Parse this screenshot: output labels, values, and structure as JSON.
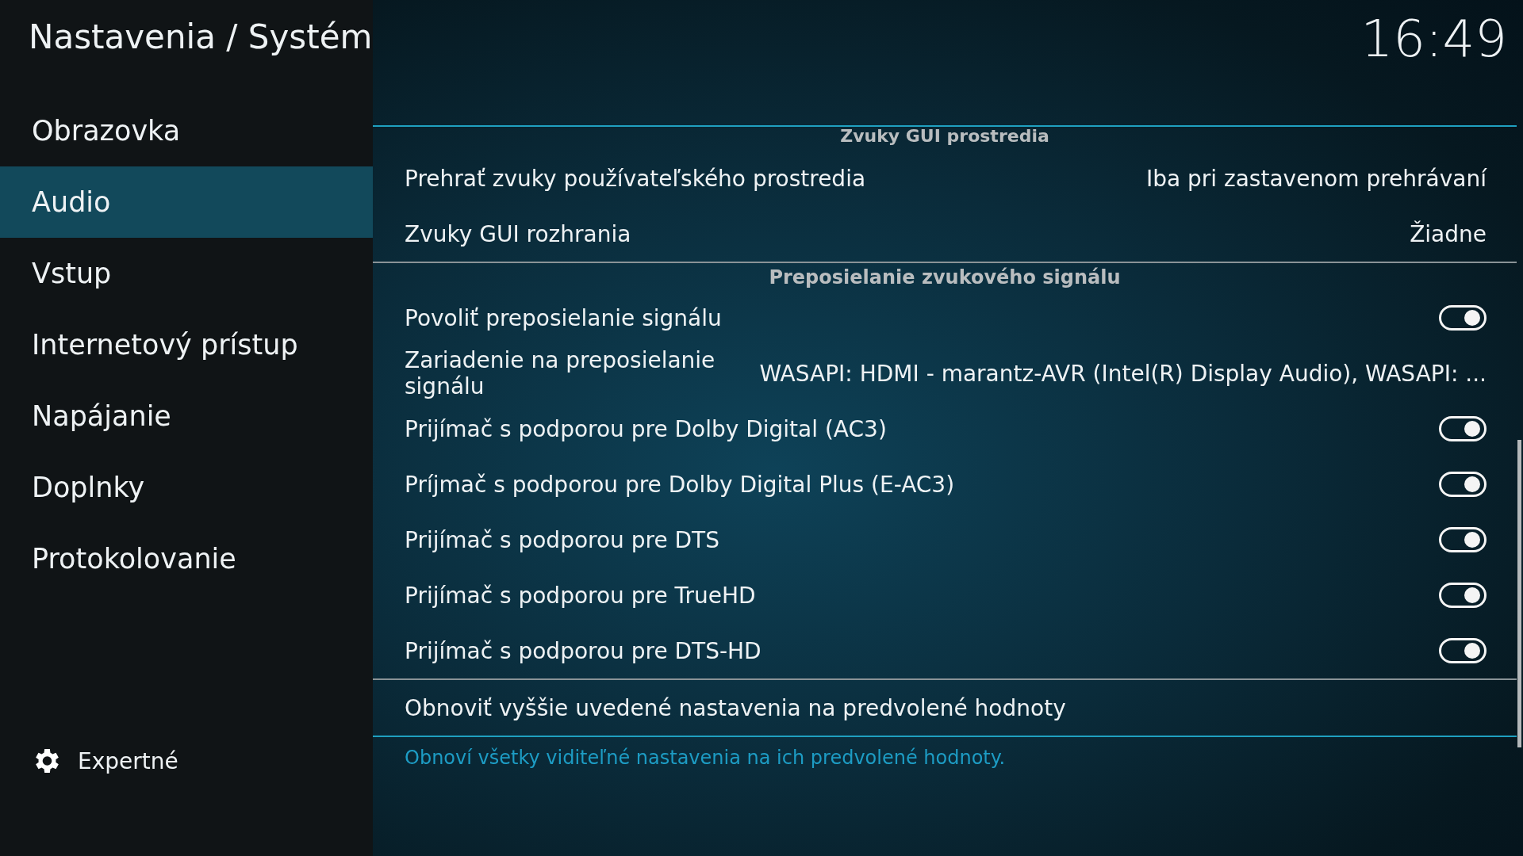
{
  "header": {
    "title": "Nastavenia / Systém",
    "clock": "16:49"
  },
  "sidebar": {
    "items": [
      {
        "label": "Obrazovka",
        "selected": false
      },
      {
        "label": "Audio",
        "selected": true
      },
      {
        "label": "Vstup",
        "selected": false
      },
      {
        "label": "Internetový prístup",
        "selected": false
      },
      {
        "label": "Napájanie",
        "selected": false
      },
      {
        "label": "Doplnky",
        "selected": false
      },
      {
        "label": "Protokolovanie",
        "selected": false
      }
    ],
    "level_button": "Expertné"
  },
  "sections": [
    {
      "title": "Zvuky GUI prostredia",
      "rows": [
        {
          "kind": "value",
          "label": "Prehrať zvuky používateľského prostredia",
          "value": "Iba pri zastavenom prehrávaní"
        },
        {
          "kind": "value",
          "label": "Zvuky GUI rozhrania",
          "value": "Žiadne"
        }
      ]
    },
    {
      "title": "Preposielanie zvukového signálu",
      "rows": [
        {
          "kind": "toggle",
          "label": "Povoliť preposielanie signálu",
          "on": true
        },
        {
          "kind": "value",
          "label": "Zariadenie na preposielanie signálu",
          "value": "WASAPI: HDMI - marantz-AVR (Intel(R) Display Audio), WASAPI: ..."
        },
        {
          "kind": "toggle",
          "label": "Prijímač s podporou pre Dolby Digital (AC3)",
          "on": true
        },
        {
          "kind": "toggle",
          "label": "Príjmač s podporou pre Dolby Digital Plus (E-AC3)",
          "on": true
        },
        {
          "kind": "toggle",
          "label": "Prijímač s podporou pre DTS",
          "on": true
        },
        {
          "kind": "toggle",
          "label": "Prijímač s podporou pre TrueHD",
          "on": true
        },
        {
          "kind": "toggle",
          "label": "Prijímač s podporou pre DTS-HD",
          "on": true
        }
      ]
    }
  ],
  "reset": {
    "label": "Obnoviť vyššie uvedené nastavenia na predvolené hodnoty",
    "description": "Obnoví všetky viditeľné nastavenia na ich predvolené hodnoty."
  }
}
